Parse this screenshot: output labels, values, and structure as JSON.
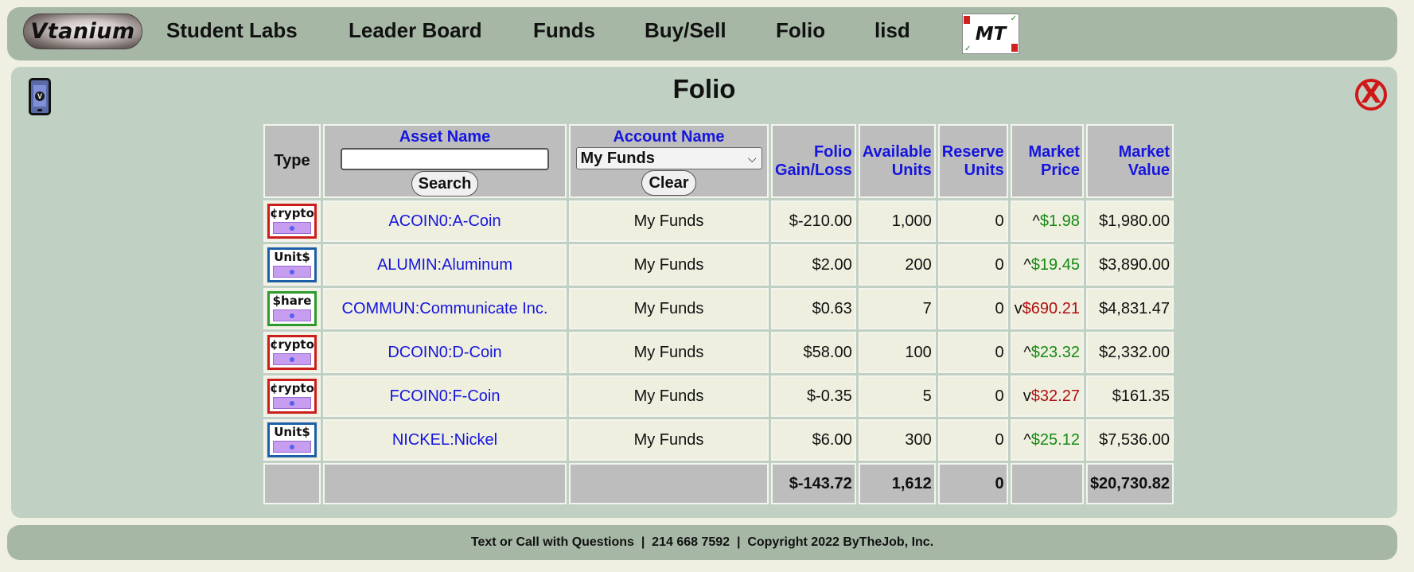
{
  "nav": {
    "logo": "Vtanium",
    "links": [
      "Student Labs",
      "Leader Board",
      "Funds",
      "Buy/Sell",
      "Folio",
      "lisd"
    ],
    "badge": "MT"
  },
  "page": {
    "title": "Folio",
    "phone_badge": "V",
    "close_symbol": "X"
  },
  "table": {
    "headers": {
      "type": "Type",
      "asset_name": "Asset Name",
      "account_name": "Account Name",
      "gain_loss": [
        "Folio",
        "Gain/Loss"
      ],
      "available": [
        "Available",
        "Units"
      ],
      "reserve": [
        "Reserve",
        "Units"
      ],
      "price": [
        "Market",
        "Price"
      ],
      "value": [
        "Market",
        "Value"
      ]
    },
    "search": {
      "value": "",
      "button": "Search"
    },
    "account_select": {
      "selected": "My Funds",
      "button": "Clear"
    },
    "rows": [
      {
        "type": "crypto",
        "type_label": "¢rypto",
        "asset": "ACOIN0:A-Coin",
        "account": "My Funds",
        "gain_loss": "$-210.00",
        "available": "1,000",
        "reserve": "0",
        "trend": "^",
        "price": "$1.98",
        "direction": "up",
        "value": "$1,980.00"
      },
      {
        "type": "unit",
        "type_label": "Unit$",
        "asset": "ALUMIN:Aluminum",
        "account": "My Funds",
        "gain_loss": "$2.00",
        "available": "200",
        "reserve": "0",
        "trend": "^",
        "price": "$19.45",
        "direction": "up",
        "value": "$3,890.00"
      },
      {
        "type": "share",
        "type_label": "$hare",
        "asset": "COMMUN:Communicate Inc.",
        "account": "My Funds",
        "gain_loss": "$0.63",
        "available": "7",
        "reserve": "0",
        "trend": "v",
        "price": "$690.21",
        "direction": "down",
        "value": "$4,831.47"
      },
      {
        "type": "crypto",
        "type_label": "¢rypto",
        "asset": "DCOIN0:D-Coin",
        "account": "My Funds",
        "gain_loss": "$58.00",
        "available": "100",
        "reserve": "0",
        "trend": "^",
        "price": "$23.32",
        "direction": "up",
        "value": "$2,332.00"
      },
      {
        "type": "crypto",
        "type_label": "¢rypto",
        "asset": "FCOIN0:F-Coin",
        "account": "My Funds",
        "gain_loss": "$-0.35",
        "available": "5",
        "reserve": "0",
        "trend": "v",
        "price": "$32.27",
        "direction": "down",
        "value": "$161.35"
      },
      {
        "type": "unit",
        "type_label": "Unit$",
        "asset": "NICKEL:Nickel",
        "account": "My Funds",
        "gain_loss": "$6.00",
        "available": "300",
        "reserve": "0",
        "trend": "^",
        "price": "$25.12",
        "direction": "up",
        "value": "$7,536.00"
      }
    ],
    "totals": {
      "gain_loss": "$-143.72",
      "available": "1,612",
      "reserve": "0",
      "value": "$20,730.82"
    }
  },
  "footer": {
    "text": "Text or Call with Questions  |  214 668 7592  |  Copyright 2022 ByTheJob, Inc."
  },
  "colors": {
    "nav_bg": "#a6b8a5",
    "panel_bg": "#c0d0c3",
    "page_bg": "#efefe2",
    "header_link": "#1515dd",
    "price_up": "#138a13",
    "price_down": "#b01010",
    "crypto_border": "#cc1d1d",
    "unit_border": "#1c5fa8",
    "share_border": "#2e9a2e"
  }
}
